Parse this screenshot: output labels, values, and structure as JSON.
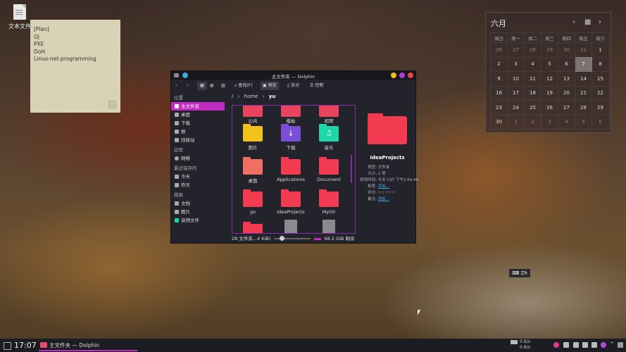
{
  "desktop": {
    "icon_label": "文本文件"
  },
  "note": {
    "lines": [
      "[Plan]",
      "Oj",
      "PXE",
      "DoH",
      "Linux-net-programming"
    ]
  },
  "calendar": {
    "month": "六月",
    "weekdays": [
      "周日",
      "周一",
      "周二",
      "周三",
      "周四",
      "周五",
      "周六"
    ],
    "weeks": [
      [
        "26",
        "27",
        "28",
        "29",
        "30",
        "31",
        "1"
      ],
      [
        "2",
        "3",
        "4",
        "5",
        "6",
        "7",
        "8"
      ],
      [
        "9",
        "10",
        "11",
        "12",
        "13",
        "14",
        "15"
      ],
      [
        "16",
        "17",
        "18",
        "19",
        "20",
        "21",
        "22"
      ],
      [
        "23",
        "24",
        "25",
        "26",
        "27",
        "28",
        "29"
      ],
      [
        "30",
        "1",
        "2",
        "3",
        "4",
        "5",
        "6"
      ]
    ],
    "today": "7"
  },
  "dolphin": {
    "title": "主文件夹 — Dolphin",
    "toolbar": {
      "search": "查找(F)",
      "preview": "预览",
      "split": "拆分",
      "control": "控制"
    },
    "sidebar": {
      "places_header": "位置",
      "places": [
        "主文件夹",
        "桌面",
        "下载",
        "根",
        "回收站"
      ],
      "remote_header": "远程",
      "remote": [
        "网络"
      ],
      "recent_header": "最近保存的",
      "recent": [
        "今天",
        "昨天"
      ],
      "search_header": "搜索",
      "search": [
        "文档",
        "图片",
        "音频文件"
      ]
    },
    "breadcrumb": {
      "root": "/",
      "home": "home",
      "user": "yu"
    },
    "items": [
      {
        "name": "公共",
        "color": "#e8445e"
      },
      {
        "name": "模板",
        "color": "#e8445e"
      },
      {
        "name": "视频",
        "color": "#e8445e"
      },
      {
        "name": "图片",
        "color": "#f2c21b"
      },
      {
        "name": "下载",
        "color": "#7a4fd8"
      },
      {
        "name": "音乐",
        "color": "#1dd6a9"
      },
      {
        "name": "桌面",
        "color": "#ef6f62"
      },
      {
        "name": "Applications",
        "color": "#f23a50"
      },
      {
        "name": "Document",
        "color": "#f23a50"
      },
      {
        "name": "go",
        "color": "#f23a50"
      },
      {
        "name": "IdeaProjects",
        "color": "#f23a50"
      },
      {
        "name": "MyGit",
        "color": "#f23a50"
      }
    ],
    "info": {
      "name": "IdeaProjects",
      "type_label": "类型:",
      "type": "文件夹",
      "size_label": "大小:",
      "size": "2 项",
      "modified_label": "修改时间:",
      "modified": "今天 CST 下午1:59:46",
      "tags_label": "标签:",
      "tags": "添加...",
      "rating_label": "评分:",
      "rating": "☆☆☆☆☆",
      "comment_label": "备注:",
      "comment": "添加..."
    },
    "status": {
      "left": "28 文件夹...4 KiB)",
      "right": "68.2 GiB 剩余"
    }
  },
  "ime": {
    "label": "Zh"
  },
  "taskbar": {
    "time": "17:07",
    "task": "主文件夹 — Dolphin",
    "net_up": "0 B/s",
    "net_down": "0 B/s"
  }
}
